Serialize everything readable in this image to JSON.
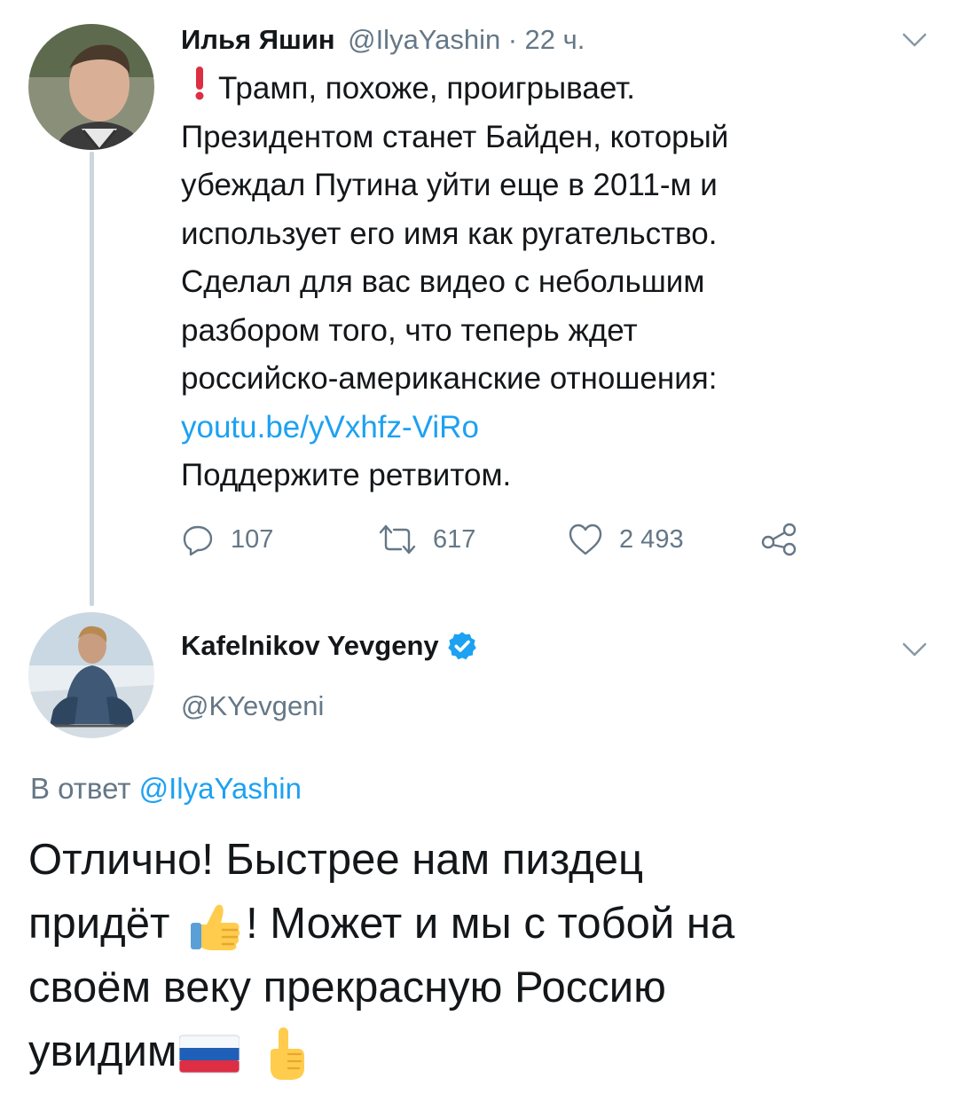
{
  "tweet1": {
    "name": "Илья Яшин",
    "handle": "@IlyaYashin",
    "separator": "·",
    "time": "22 ч.",
    "lines": [
      "Трамп, похоже, проигрывает.",
      "Президентом станет Байден, который",
      "убеждал Путина уйти еще в 2011-м и",
      "использует его имя как ругательство.",
      "Сделал для вас видео с небольшим",
      "разбором того, что теперь ждет",
      "российско-американские отношения:"
    ],
    "link": "youtu.be/yVxhfz-ViRo",
    "last_line": "Поддержите ретвитом.",
    "replies": "107",
    "retweets": "617",
    "likes": "2 493"
  },
  "tweet2": {
    "name": "Kafelnikov Yevgeny",
    "handle": "@KYevgeni",
    "reply_prefix": "В ответ",
    "reply_handle": "@IlyaYashin",
    "line1": "Отлично! Быстрее нам пиздец",
    "line2_a": "придёт",
    "line2_b": "! Может и мы с тобой на",
    "line3": "своём веку прекрасную Россию",
    "line4": "увидим"
  },
  "colors": {
    "link": "#1da1f2",
    "muted": "#657786",
    "verified": "#1da1f2",
    "alert": "#dd2e44"
  },
  "icons": [
    "chevron-down-icon",
    "reply-icon",
    "retweet-icon",
    "like-icon",
    "share-icon",
    "verified-badge-icon",
    "thumbs-up-emoji",
    "russia-flag-emoji",
    "point-up-emoji",
    "exclamation-emoji"
  ]
}
